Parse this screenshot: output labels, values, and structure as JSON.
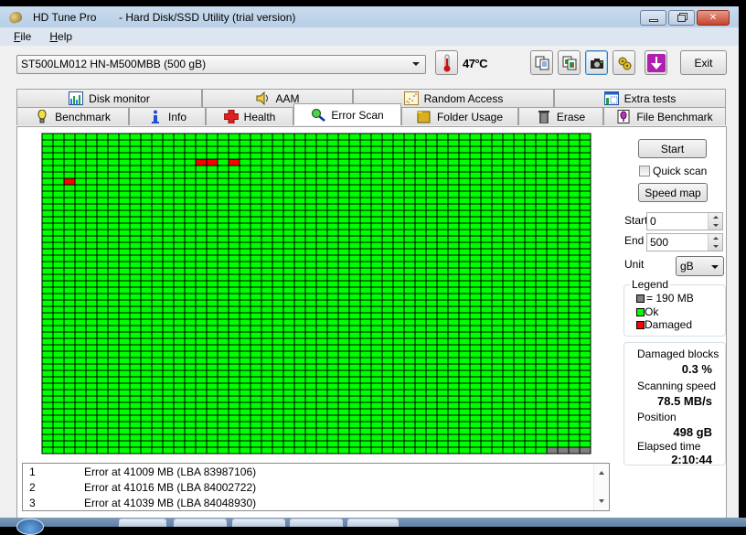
{
  "window": {
    "title_app": "HD Tune Pro",
    "title_rest": "  - Hard Disk/SSD Utility (trial version)",
    "controls": [
      "minimize",
      "restore",
      "close"
    ]
  },
  "menu": [
    {
      "label": "File",
      "accel": "F",
      "rest": "ile"
    },
    {
      "label": "Help",
      "accel": "H",
      "rest": "elp"
    }
  ],
  "toolbar": {
    "drive": "ST500LM012 HN-M500MBB (500 gB)",
    "temperature": "47°C",
    "icons": [
      "copy-text-icon",
      "copy-screenshot-icon",
      "camera-icon",
      "options-icon",
      "download-icon"
    ],
    "exit_label": "Exit"
  },
  "tabs": {
    "row1": [
      {
        "label": "Disk monitor",
        "icon": "disk-monitor-icon"
      },
      {
        "label": "AAM",
        "icon": "speaker-icon"
      },
      {
        "label": "Random Access",
        "icon": "random-access-icon"
      },
      {
        "label": "Extra tests",
        "icon": "extra-tests-icon"
      }
    ],
    "row2": [
      {
        "label": "Benchmark",
        "icon": "bulb-icon"
      },
      {
        "label": "Info",
        "icon": "info-icon"
      },
      {
        "label": "Health",
        "icon": "health-cross-icon"
      },
      {
        "label": "Error Scan",
        "icon": "magnifier-icon",
        "active": true
      },
      {
        "label": "Folder Usage",
        "icon": "folder-icon"
      },
      {
        "label": "Erase",
        "icon": "trash-icon"
      },
      {
        "label": "File Benchmark",
        "icon": "file-benchmark-icon"
      }
    ]
  },
  "scan_map": {
    "columns": 50,
    "rows": 50,
    "colors": {
      "ok": "#00ff00",
      "damaged": "#ff0000",
      "pending": "#808080",
      "border": "#000000"
    },
    "damaged_cells": [
      [
        4,
        14
      ],
      [
        4,
        15
      ],
      [
        4,
        17
      ],
      [
        7,
        2
      ]
    ],
    "pending_cells_at_end": 4
  },
  "errors": [
    {
      "num": "1",
      "message": "Error at 41009 MB (LBA 83987106)"
    },
    {
      "num": "2",
      "message": "Error at 41016 MB (LBA 84002722)"
    },
    {
      "num": "3",
      "message": "Error at 41039 MB (LBA 84048930)"
    }
  ],
  "controls": {
    "start_button": "Start",
    "quick_scan_label": "Quick scan",
    "quick_scan_checked": false,
    "speed_map_button": "Speed map",
    "start_label": "Start",
    "start_value": "0",
    "end_label": "End",
    "end_value": "500",
    "unit_label": "Unit",
    "unit_value": "gB"
  },
  "legend": {
    "title": "Legend",
    "items": [
      {
        "label": "= 190 MB",
        "color": "#808080"
      },
      {
        "label": "Ok",
        "color": "#00ff00"
      },
      {
        "label": "Damaged",
        "color": "#ff0000"
      }
    ]
  },
  "stats": {
    "damaged_blocks_label": "Damaged blocks",
    "damaged_blocks_value": "0.3 %",
    "scanning_speed_label": "Scanning speed",
    "scanning_speed_value": "78.5 MB/s",
    "position_label": "Position",
    "position_value": "498 gB",
    "elapsed_label": "Elapsed time",
    "elapsed_value": "2:10:44"
  }
}
